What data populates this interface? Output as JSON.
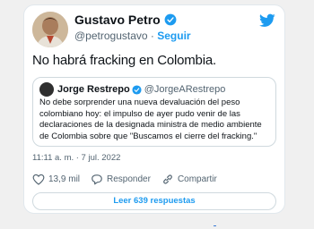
{
  "tweet": {
    "author_name": "Gustavo Petro",
    "handle": "@petrogustavo",
    "separator": " · ",
    "follow_label": "Seguir",
    "text": "No habrá fracking en Colombia.",
    "timestamp": "11:11 a. m. · 7 jul. 2022",
    "quoted": {
      "author_name": "Jorge Restrepo",
      "handle": "@JorgeARestrepo",
      "text": "No debe sorprender una nueva devaluación del peso colombiano hoy: el impulso de ayer pudo venir de las declaraciones de la designada ministra de medio ambiente de Colombia sobre que \"Buscamos el cierre del fracking.\""
    },
    "actions": {
      "likes": "13,9 mil",
      "reply_label": "Responder",
      "share_label": "Compartir"
    },
    "read_replies_label": "Leer 639 respuestas"
  },
  "colors": {
    "accent": "#1d9bf0",
    "text": "#0f1419",
    "muted": "#536471"
  },
  "icons": [
    "verified-badge-icon",
    "twitter-bird-icon",
    "heart-icon",
    "reply-icon",
    "share-link-icon"
  ]
}
